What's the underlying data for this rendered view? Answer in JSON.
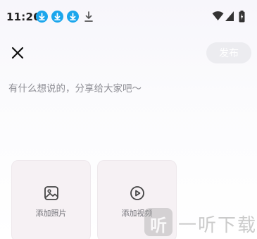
{
  "status_bar": {
    "time": "11:26",
    "notification_icons": [
      "download-icon",
      "download-icon",
      "download-icon",
      "download-plain-icon"
    ],
    "system_icons": [
      "wifi-icon",
      "cellular-signal-icon",
      "battery-icon"
    ],
    "accent_color": "#1ba6ec"
  },
  "top_bar": {
    "close_icon": "close-icon",
    "publish_label": "发布"
  },
  "composer": {
    "placeholder": "有什么想说的，分享给大家吧～",
    "value": ""
  },
  "media": {
    "photo": {
      "icon": "image-icon",
      "label": "添加照片"
    },
    "video": {
      "icon": "play-circle-icon",
      "label": "添加视频"
    }
  },
  "watermark": {
    "logo_glyph": "听",
    "text": "一听下载"
  }
}
